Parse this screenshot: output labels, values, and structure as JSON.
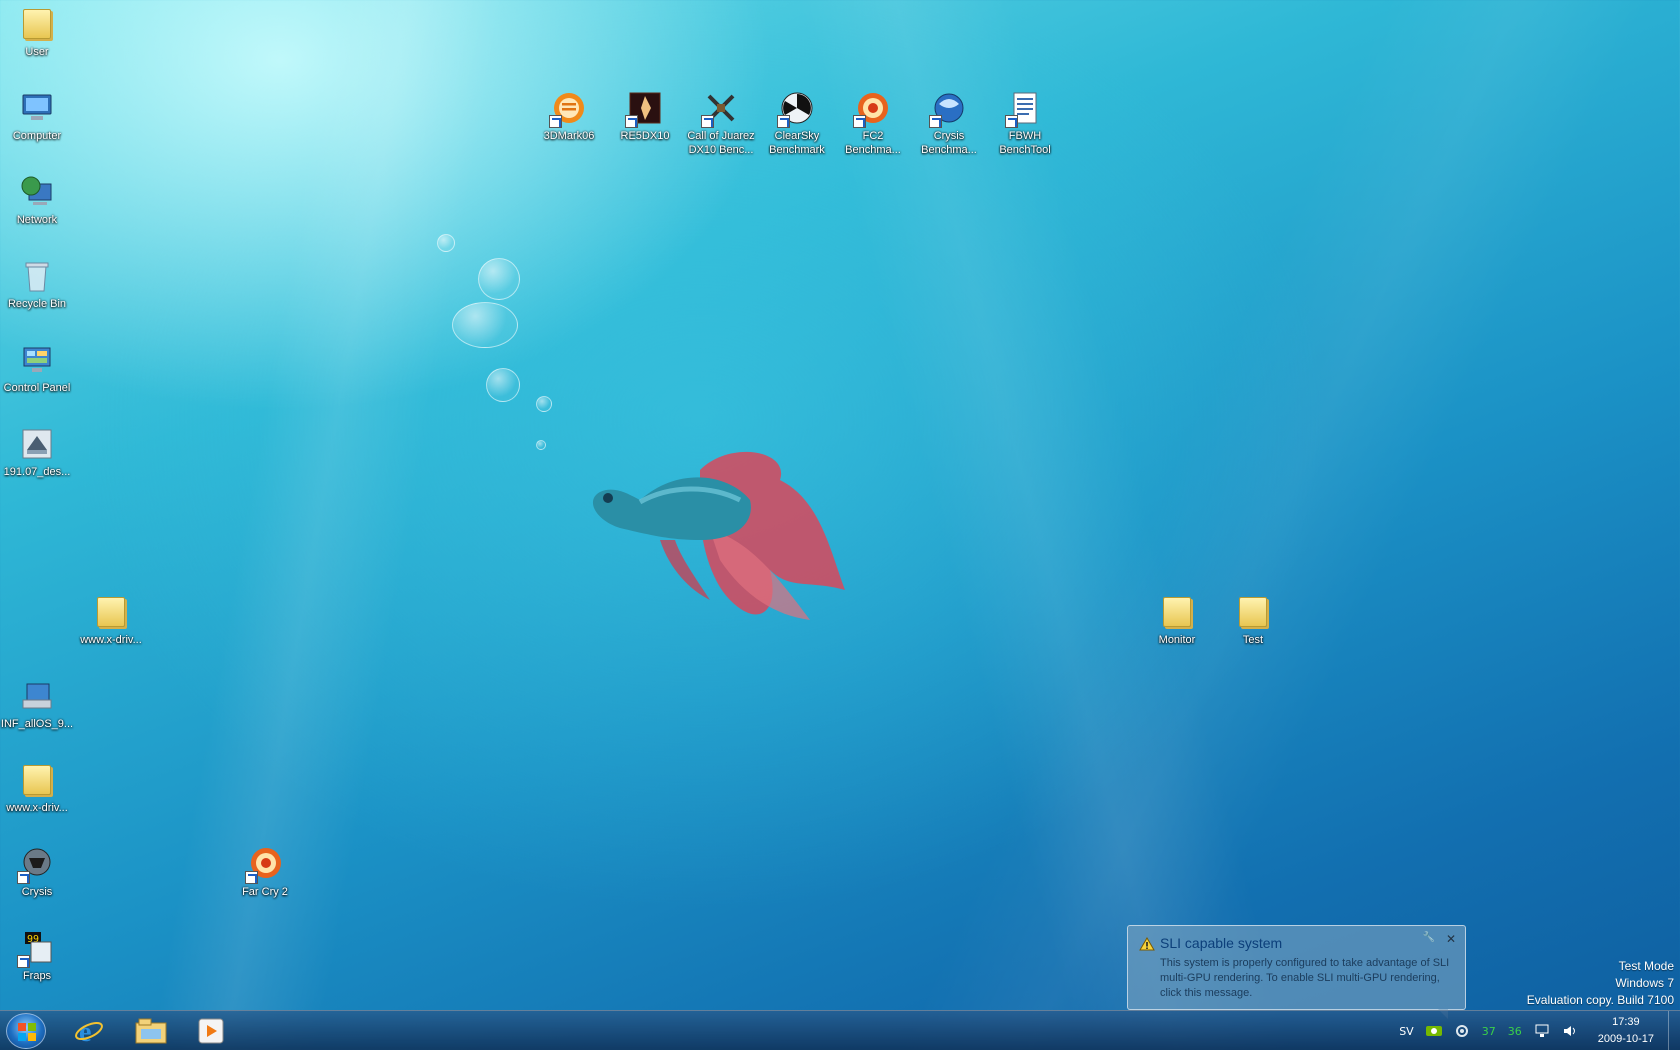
{
  "desktop_icons": {
    "user": {
      "label": "User"
    },
    "computer": {
      "label": "Computer"
    },
    "network": {
      "label": "Network"
    },
    "recycle_bin": {
      "label": "Recycle Bin"
    },
    "control_panel": {
      "label": "Control Panel"
    },
    "driver_191": {
      "label": "191.07_des..."
    },
    "xdriv_folder_1": {
      "label": "www.x-driv..."
    },
    "inf_allos": {
      "label": "INF_allOS_9..."
    },
    "xdriv_folder_2": {
      "label": "www.x-driv..."
    },
    "crysis": {
      "label": "Crysis"
    },
    "far_cry_2": {
      "label": "Far Cry 2"
    },
    "fraps": {
      "label": "Fraps"
    },
    "3dmark06": {
      "label": "3DMark06"
    },
    "re5dx10": {
      "label": "RE5DX10"
    },
    "call_of_juarez": {
      "label": "Call of Juarez\nDX10 Benc..."
    },
    "clearsky": {
      "label": "ClearSky\nBenchmark"
    },
    "fc2_bench": {
      "label": "FC2\nBenchma..."
    },
    "crysis_bench": {
      "label": "Crysis\nBenchma..."
    },
    "fbwh": {
      "label": "FBWH\nBenchTool"
    },
    "monitor": {
      "label": "Monitor"
    },
    "test": {
      "label": "Test"
    }
  },
  "notification": {
    "title": "SLI capable system",
    "body": "This system is properly configured to take advantage of SLI multi-GPU rendering. To enable SLI multi-GPU rendering, click this message.",
    "close_glyph": "✕",
    "options_glyph": "🔧"
  },
  "watermark": {
    "line1": "Test Mode",
    "line2": "Windows 7",
    "line3": "Evaluation copy. Build 7100"
  },
  "taskbar": {
    "language": "SV",
    "temp1": "37",
    "temp2": "36",
    "time": "17:39",
    "date": "2009-10-17"
  }
}
